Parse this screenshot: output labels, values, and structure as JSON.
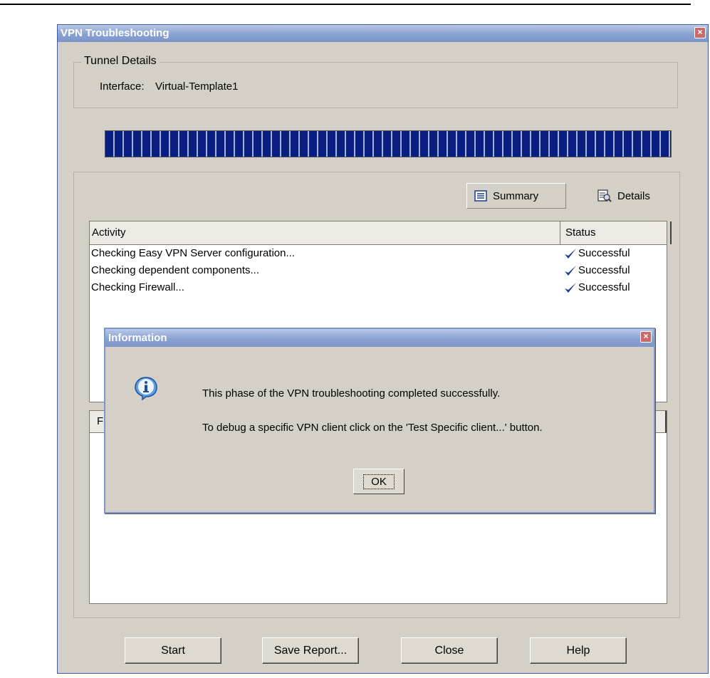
{
  "window": {
    "title": "VPN Troubleshooting",
    "close": "×"
  },
  "tunnel": {
    "legend": "Tunnel Details",
    "interface_label": "Interface:",
    "interface_value": "Virtual-Template1"
  },
  "progress": {
    "fraction": 1.0
  },
  "tabs": {
    "summary": "Summary",
    "details": "Details"
  },
  "table": {
    "columns": [
      "Activity",
      "Status"
    ],
    "rows": [
      {
        "activity": "Checking Easy VPN Server configuration...",
        "status": "Successful"
      },
      {
        "activity": "Checking dependent components...",
        "status": "Successful"
      },
      {
        "activity": "Checking Firewall...",
        "status": "Successful"
      }
    ]
  },
  "lower_table": {
    "header": "F"
  },
  "buttons": {
    "start": "Start",
    "save_report": "Save Report...",
    "close": "Close",
    "help": "Help"
  },
  "dialog": {
    "title": "Information",
    "close": "×",
    "line1": "This phase of the VPN troubleshooting completed successfully.",
    "line2": "To debug a specific VPN client click on the 'Test Specific client...' button.",
    "ok": "OK"
  },
  "colors": {
    "progress": "#0a1e80",
    "titlebar": "#8aa2d2",
    "check": "#1e3e8a"
  }
}
